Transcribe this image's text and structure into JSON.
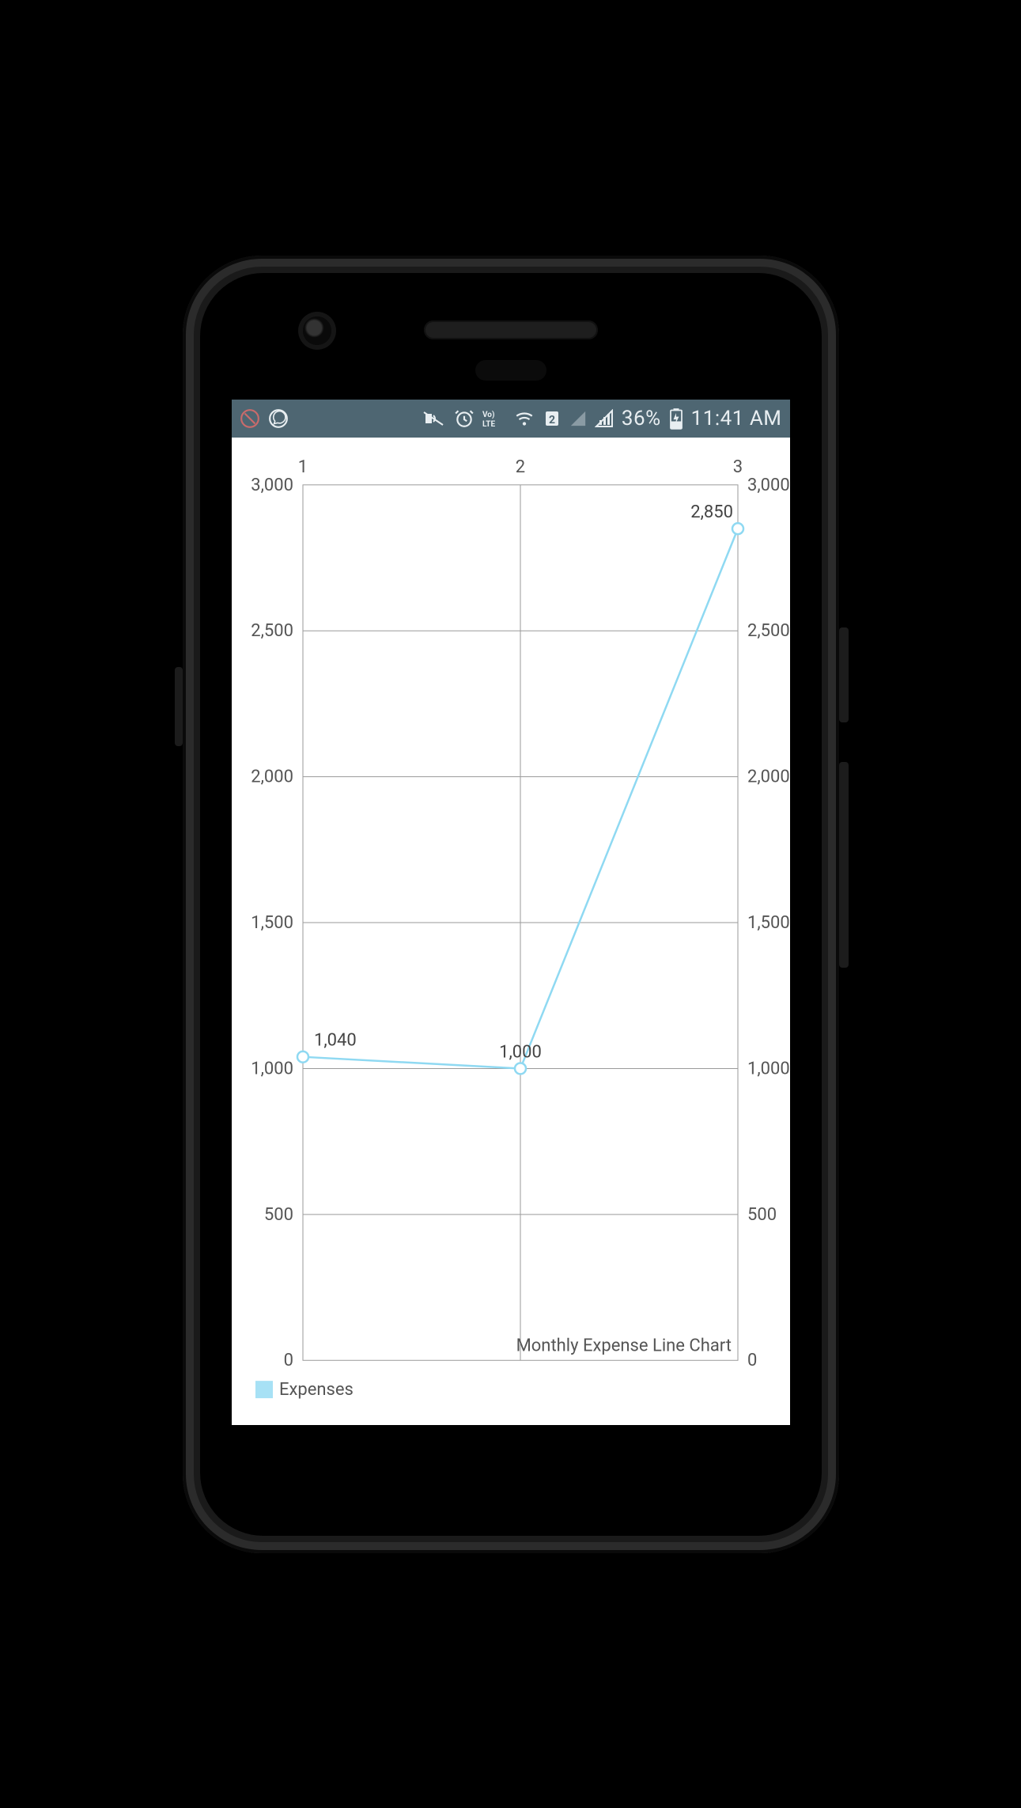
{
  "statusbar": {
    "time": "11:41 AM",
    "battery_text": "36%",
    "icons_left": [
      "no-sim-icon",
      "whatsapp-icon"
    ],
    "icons_right": [
      "vibrate-icon",
      "alarm-icon",
      "volte-icon",
      "wifi-icon",
      "sim2-icon",
      "signal1-icon",
      "signal2-icon",
      "battery-charging-icon"
    ]
  },
  "chart": {
    "x_ticks": [
      "1",
      "2",
      "3"
    ],
    "y_ticks_left": [
      "3,000",
      "2,500",
      "2,000",
      "1,500",
      "1,000",
      "500",
      "0"
    ],
    "y_ticks_right": [
      "3,000",
      "2,500",
      "2,000",
      "1,500",
      "1,000",
      "500",
      "0"
    ],
    "data_labels": [
      "1,040",
      "1,000",
      "2,850"
    ],
    "description": "Monthly Expense Line Chart",
    "legend_label": "Expenses",
    "legend_color": "#a7e1f5",
    "line_color": "#8fd9f2"
  },
  "chart_data": {
    "type": "line",
    "title": "",
    "xlabel": "",
    "ylabel": "",
    "description": "Monthly Expense Line Chart",
    "x": [
      1,
      2,
      3
    ],
    "series": [
      {
        "name": "Expenses",
        "values": [
          1040,
          1000,
          2850
        ],
        "color": "#8fd9f2"
      }
    ],
    "ylim": [
      0,
      3000
    ],
    "xlim": [
      1,
      3
    ],
    "y_ticks": [
      0,
      500,
      1000,
      1500,
      2000,
      2500,
      3000
    ],
    "x_ticks": [
      1,
      2,
      3
    ],
    "grid": true,
    "legend_position": "bottom-left"
  }
}
